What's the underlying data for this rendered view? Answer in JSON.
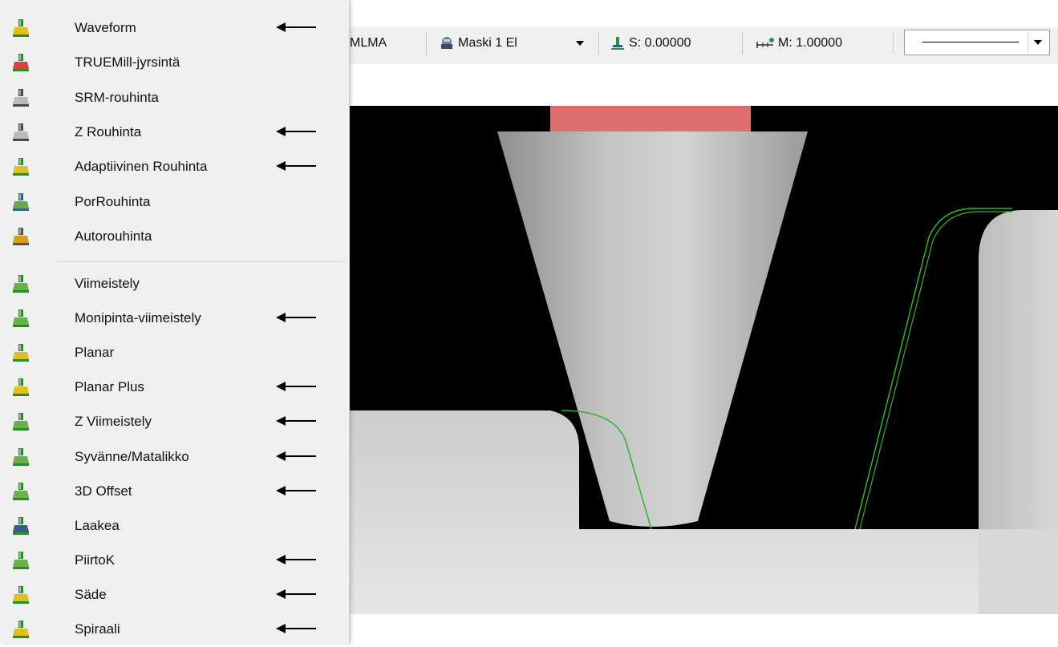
{
  "toolbar": {
    "mlma_label": "MLMA",
    "mask_label": "Maski  1 El",
    "s_label": "S: 0.00000",
    "m_label": "M: 1.00000"
  },
  "menu": {
    "items": [
      {
        "label": "Waveform",
        "arrow": true,
        "icon": "waveform-icon"
      },
      {
        "label": "TRUEMill-jyrsintä",
        "arrow": false,
        "icon": "truemill-icon"
      },
      {
        "label": "SRM-rouhinta",
        "arrow": false,
        "icon": "srm-rough-icon"
      },
      {
        "label": "Z Rouhinta",
        "arrow": true,
        "icon": "z-rough-icon"
      },
      {
        "label": "Adaptiivinen Rouhinta",
        "arrow": true,
        "icon": "adaptive-rough-icon"
      },
      {
        "label": "PorRouhinta",
        "arrow": false,
        "icon": "plunge-rough-icon"
      },
      {
        "label": "Autorouhinta",
        "arrow": false,
        "icon": "auto-rough-icon"
      },
      {
        "label": "Viimeistely",
        "arrow": false,
        "icon": "finish-icon"
      },
      {
        "label": "Monipinta-viimeistely",
        "arrow": true,
        "icon": "multisurface-finish-icon"
      },
      {
        "label": "Planar",
        "arrow": false,
        "icon": "planar-icon"
      },
      {
        "label": "Planar Plus",
        "arrow": true,
        "icon": "planar-plus-icon"
      },
      {
        "label": "Z Viimeistely",
        "arrow": true,
        "icon": "z-finish-icon"
      },
      {
        "label": "Syvänne/Matalikko",
        "arrow": true,
        "icon": "steep-shallow-icon"
      },
      {
        "label": "3D Offset",
        "arrow": true,
        "icon": "3d-offset-icon"
      },
      {
        "label": "Laakea",
        "arrow": false,
        "icon": "flat-icon"
      },
      {
        "label": "PiirtoK",
        "arrow": true,
        "icon": "pencil-icon"
      },
      {
        "label": "Säde",
        "arrow": true,
        "icon": "radial-icon"
      },
      {
        "label": "Spiraali",
        "arrow": true,
        "icon": "spiral-icon"
      }
    ]
  },
  "colors": {
    "menu_bg": "#f0f0f0",
    "viewport_bg": "#000000",
    "toolpath": "#2fb52f",
    "holder": "#e07070",
    "part": "#cfcfcf"
  }
}
